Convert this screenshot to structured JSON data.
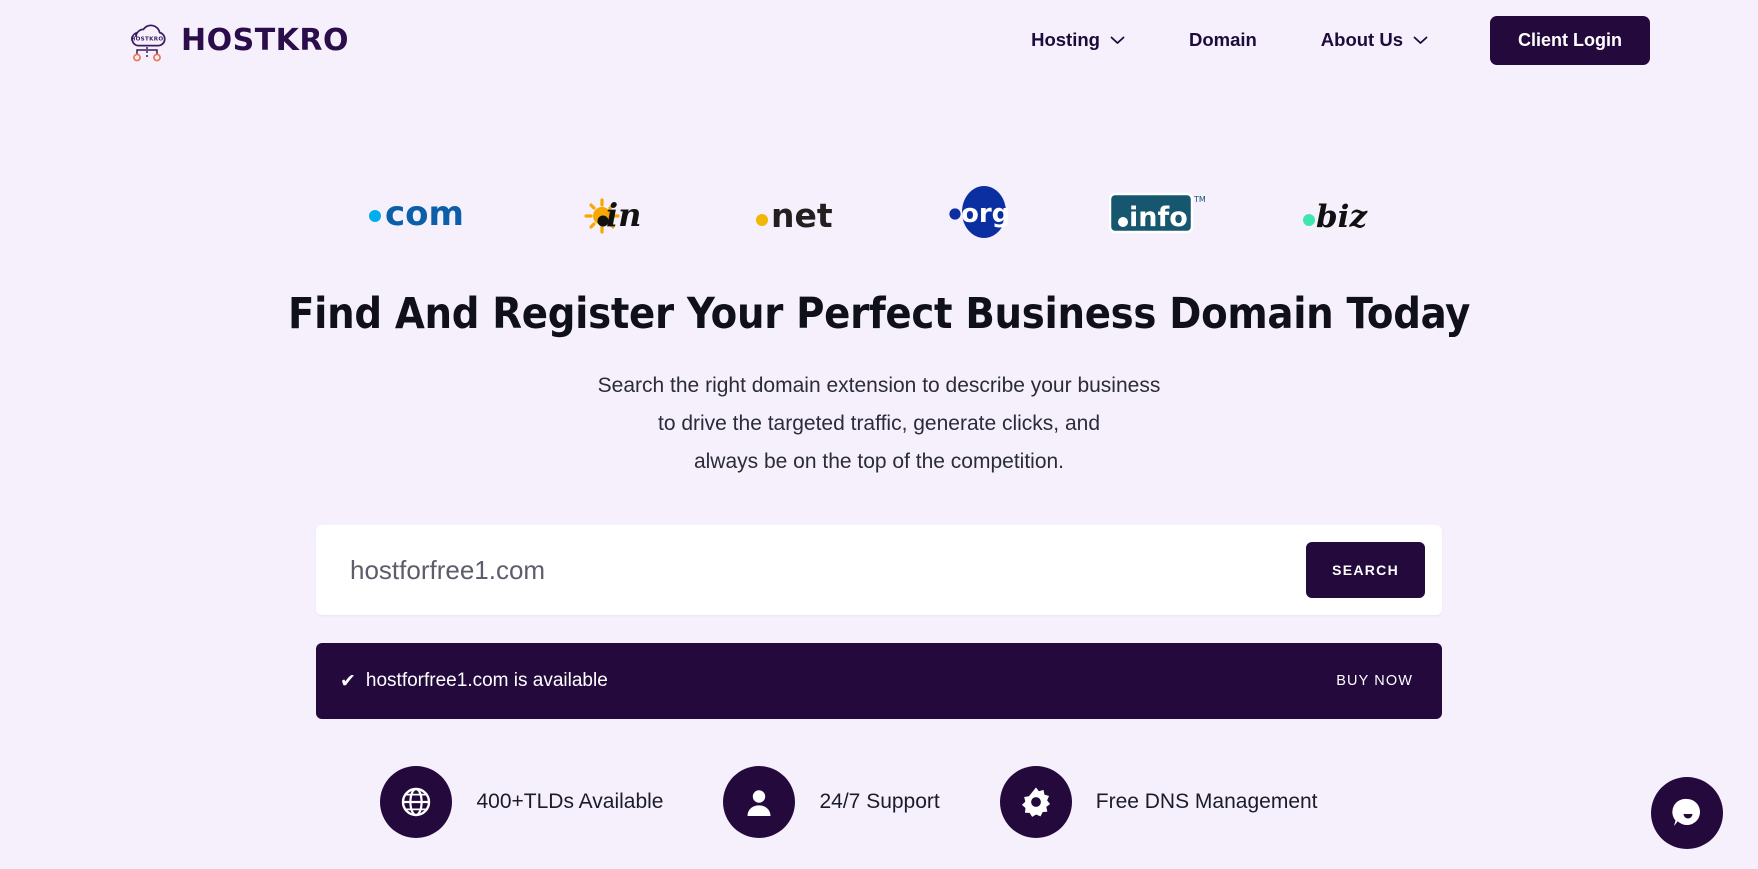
{
  "theme": {
    "background": "#f5f0fc",
    "primary_dark": "#240a3c",
    "surface": "#ffffff",
    "accent_orange": "#f2714a"
  },
  "header": {
    "brand": {
      "icon": "cloud-network-logo-icon",
      "wordmark": "HOSTKRO",
      "mark_label": "HOSTKRO"
    },
    "nav": [
      {
        "label": "Hosting",
        "has_dropdown": true,
        "icon": "chevron-down-icon"
      },
      {
        "label": "Domain",
        "has_dropdown": false,
        "icon": ""
      },
      {
        "label": "About Us",
        "has_dropdown": true,
        "icon": "chevron-down-icon"
      }
    ],
    "login_button": "Client Login"
  },
  "tlds": [
    {
      "name": "com",
      "display": ".com",
      "dot_color": "#00aeef",
      "text_color": "#0a5fa8",
      "style": "com"
    },
    {
      "name": "in",
      "display": ".in",
      "dot_color": "#111111",
      "text_color": "#111111",
      "style": "in",
      "accent": "#f7a800"
    },
    {
      "name": "net",
      "display": ".net",
      "dot_color": "#f2b705",
      "text_color": "#231f20",
      "style": "net"
    },
    {
      "name": "org",
      "display": ".org",
      "dot_color": "#ffffff",
      "text_color": "#ffffff",
      "style": "org",
      "badge_color": "#0b2ea0"
    },
    {
      "name": "info",
      "display": ".info",
      "dot_color": "#ffffff",
      "text_color": "#ffffff",
      "style": "info",
      "badge_color": "#17566f",
      "tm": "TM"
    },
    {
      "name": "biz",
      "display": ".biz",
      "dot_color": "#3ee6b0",
      "text_color": "#111111",
      "style": "biz"
    }
  ],
  "hero": {
    "title": "Find And Register Your Perfect Business Domain Today",
    "subtitle_lines": [
      "Search the right domain extension to describe your business",
      "to drive the targeted traffic, generate clicks, and",
      "always be on the top of the competition."
    ]
  },
  "search": {
    "value": "hostforfree1.com",
    "placeholder": "hostforfree1.com",
    "button_label": "SEARCH"
  },
  "result": {
    "status_icon": "check-icon",
    "check_glyph": "✔",
    "message": "hostforfree1.com is available",
    "action_label": "BUY NOW"
  },
  "features": [
    {
      "icon": "globe-icon",
      "label": "400+TLDs Available"
    },
    {
      "icon": "user-icon",
      "label": "24/7 Support"
    },
    {
      "icon": "gear-icon",
      "label": "Free DNS Management"
    }
  ],
  "chat": {
    "icon": "chat-bubble-icon",
    "aria_label": "Open chat"
  }
}
